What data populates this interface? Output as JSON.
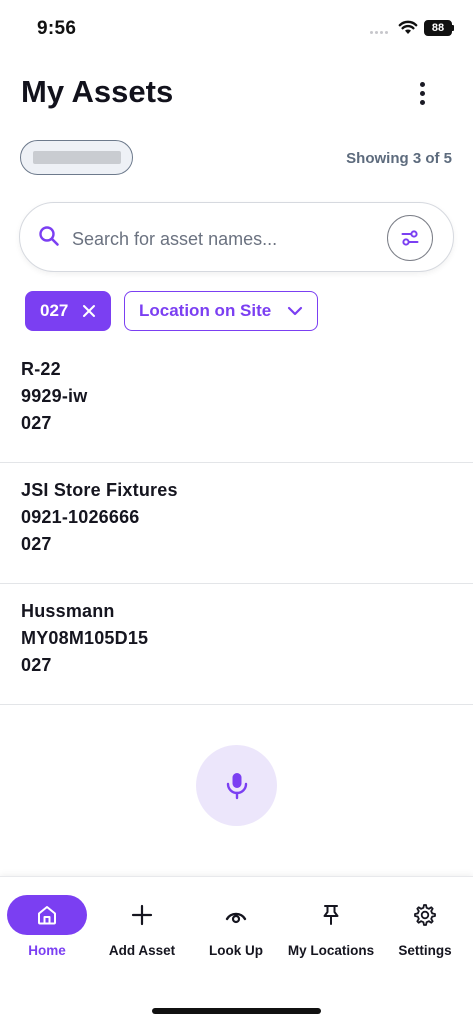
{
  "status_bar": {
    "time": "9:56",
    "battery": "88"
  },
  "header": {
    "title": "My Assets"
  },
  "summary": {
    "showing": "Showing 3 of 5"
  },
  "search": {
    "placeholder": "Search for asset names..."
  },
  "filters": {
    "active_chip": "027",
    "dropdown_label": "Location on Site"
  },
  "assets": [
    {
      "name": "R-22",
      "serial": "9929-iw",
      "location": "027"
    },
    {
      "name": "JSI Store Fixtures",
      "serial": "0921-1026666",
      "location": "027"
    },
    {
      "name": "Hussmann",
      "serial": "MY08M105D15",
      "location": "027"
    }
  ],
  "nav": [
    {
      "label": "Home",
      "icon": "home-icon",
      "active": true
    },
    {
      "label": "Add Asset",
      "icon": "plus-icon",
      "active": false
    },
    {
      "label": "Look Up",
      "icon": "eye-icon",
      "active": false
    },
    {
      "label": "My Locations",
      "icon": "pin-icon",
      "active": false
    },
    {
      "label": "Settings",
      "icon": "gear-icon",
      "active": false
    }
  ],
  "colors": {
    "accent": "#7b3ff2",
    "accent_soft": "#ece6fb",
    "muted": "#5d6b7d"
  }
}
